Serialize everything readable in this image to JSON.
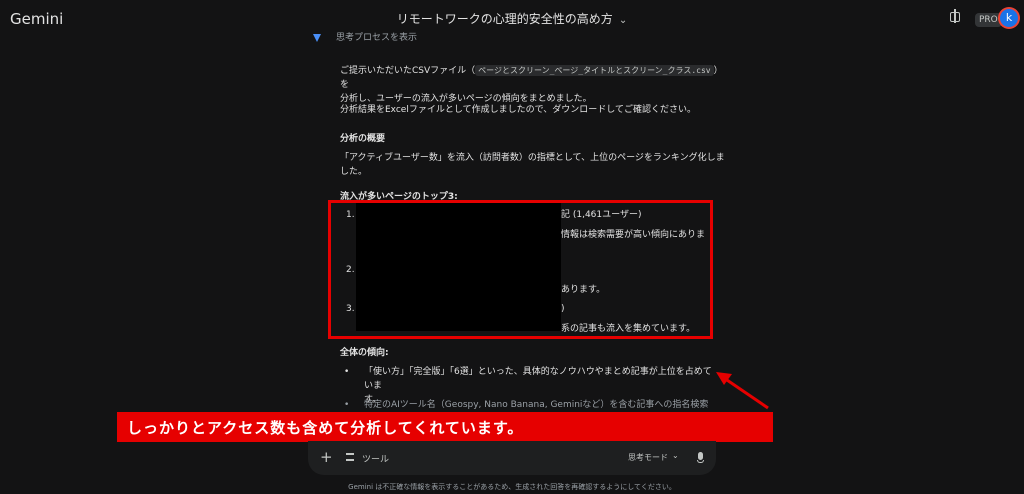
{
  "header": {
    "brand": "Gemini",
    "conversation_title": "リモートワークの心理的安全性の高め方",
    "pro_badge": "PRO",
    "avatar_letter": "k"
  },
  "thinking": {
    "label": "思考プロセスを表示"
  },
  "response": {
    "intro_before": "ご提示いただいたCSVファイル（",
    "file_name": "ページとスクリーン_ページ_タイトルとスクリーン_クラス.csv",
    "intro_after": "）を",
    "intro_line2": "分析し、ユーザーの流入が多いページの傾向をまとめました。",
    "excel_note": "分析結果をExcelファイルとして作成しましたので、ダウンロードしてご確認ください。",
    "summary_heading": "分析の概要",
    "summary_text": "「アクティブユーザー数」を流入（訪問者数）の指標として、上位のページをランキング化しました。",
    "top_heading": "流入が多いページのトップ3:",
    "top_items": [
      {
        "num": "1.",
        "line1": "記 (1,461ユーザー)",
        "line2": "情報は検索需要が高い傾向にありま"
      },
      {
        "num": "2.",
        "line1": "",
        "line2": "あります。"
      },
      {
        "num": "3.",
        "line1": ")",
        "line2": "系の記事も流入を集めています。"
      }
    ],
    "trend_heading": "全体の傾向:",
    "trend_items": [
      {
        "line1": "「使い方」「完全版」「6選」といった、具体的なノウハウやまとめ記事が上位を占めていま",
        "line2": "す。"
      },
      {
        "line1": "特定のAIツール名（Geospy, Nano Banana, Geminiなど）を含む記事への指名検索的な流入",
        "line2": ""
      }
    ]
  },
  "annotation": {
    "banner_text": "しっかりとアクセス数も含めて分析してくれています。"
  },
  "input_bar": {
    "tools_label": "ツール",
    "mode_label": "思考モード"
  },
  "footer": {
    "disclaimer": "Gemini は不正確な情報を表示することがあるため、生成された回答を再確認するようにしてください。"
  },
  "colors": {
    "background": "#131314",
    "highlight_red": "#e60000",
    "accent_blue": "#4a8ff7"
  }
}
